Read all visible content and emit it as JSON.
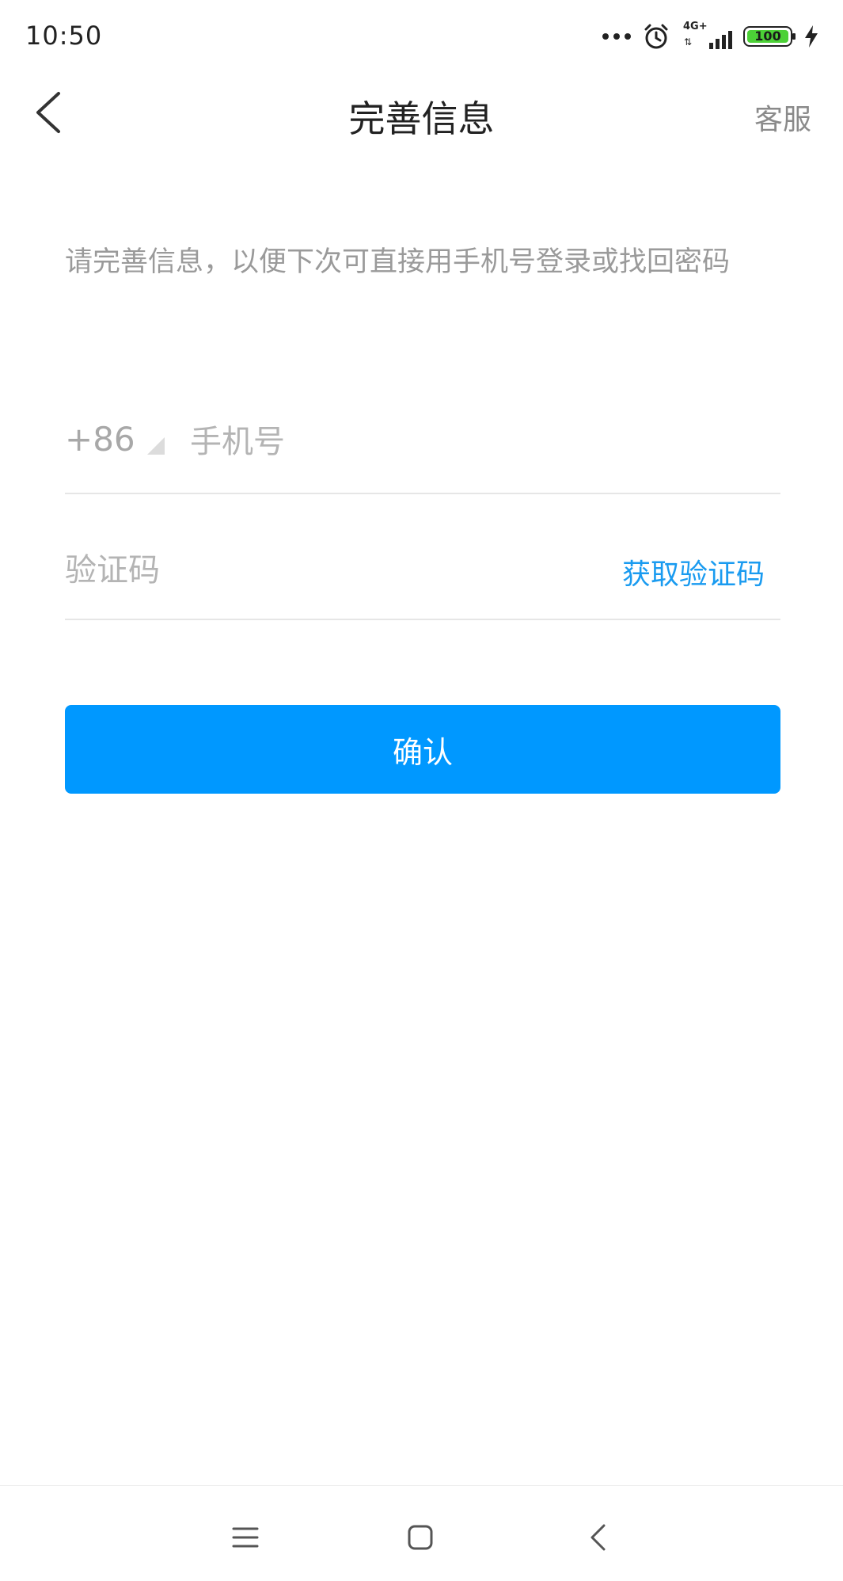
{
  "status_bar": {
    "time": "10:50",
    "network_label": "4G+",
    "battery_level": "100",
    "icons": [
      "more-dots-icon",
      "alarm-icon",
      "signal-icon",
      "battery-icon",
      "charging-bolt-icon"
    ]
  },
  "nav": {
    "title": "完善信息",
    "service_label": "客服",
    "back_icon": "back-arrow-icon"
  },
  "hint_text": "请完善信息，以便下次可直接用手机号登录或找回密码",
  "phone": {
    "country_code": "+86",
    "placeholder": "手机号",
    "value": ""
  },
  "code": {
    "placeholder": "验证码",
    "value": "",
    "get_code_label": "获取验证码"
  },
  "confirm_label": "确认",
  "colors": {
    "primary": "#0098ff",
    "link": "#1a9bf0",
    "hint_text": "#9a9a9a",
    "divider": "#e6e6e6",
    "battery_fill": "#4cd137"
  },
  "system_nav": {
    "icons": [
      "menu-icon",
      "home-icon",
      "back-icon"
    ]
  }
}
